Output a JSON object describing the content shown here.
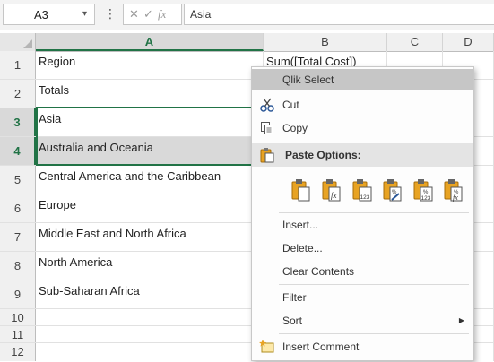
{
  "formula_bar": {
    "name_box": "A3",
    "name_box_dropdown": "▾",
    "more_icon": "⋮",
    "cancel_icon": "✕",
    "enter_icon": "✓",
    "fx_icon": "fx",
    "formula": "Asia"
  },
  "columns": [
    {
      "label": "",
      "name": "corner"
    },
    {
      "label": "A",
      "name": "col-a"
    },
    {
      "label": "B",
      "name": "col-b"
    },
    {
      "label": "C",
      "name": "col-c"
    },
    {
      "label": "D",
      "name": "col-d"
    }
  ],
  "rows": [
    {
      "num": "1",
      "a": "Region",
      "b": "Sum([Total Cost])"
    },
    {
      "num": "2",
      "a": "Totals",
      "b": ""
    },
    {
      "num": "3",
      "a": "Asia",
      "b": ""
    },
    {
      "num": "4",
      "a": "Australia and Oceania",
      "b": ""
    },
    {
      "num": "5",
      "a": "Central America and the Caribbean",
      "b": ""
    },
    {
      "num": "6",
      "a": "Europe",
      "b": ""
    },
    {
      "num": "7",
      "a": "Middle East and North Africa",
      "b": ""
    },
    {
      "num": "8",
      "a": "North America",
      "b": ""
    },
    {
      "num": "9",
      "a": "Sub-Saharan Africa",
      "b": ""
    },
    {
      "num": "10",
      "a": "",
      "b": ""
    },
    {
      "num": "11",
      "a": "",
      "b": ""
    },
    {
      "num": "12",
      "a": "",
      "b": ""
    }
  ],
  "context_menu": {
    "qlik_select": "Qlik Select",
    "cut": "Cut",
    "copy": "Copy",
    "paste_options": "Paste Options:",
    "paste_icon_names": [
      "paste-icon",
      "paste-formulas-icon",
      "paste-values-icon",
      "paste-formatting-icon",
      "paste-values-number-format-icon",
      "paste-formulas-number-format-icon"
    ],
    "insert": "Insert...",
    "delete": "Delete...",
    "clear_contents": "Clear Contents",
    "filter": "Filter",
    "sort": "Sort",
    "insert_comment": "Insert Comment"
  },
  "colors": {
    "excel_green": "#217346",
    "selection_gray": "#d9d9d9",
    "menu_highlight": "#c6c6c6",
    "clipboard_orange": "#e8a323"
  }
}
